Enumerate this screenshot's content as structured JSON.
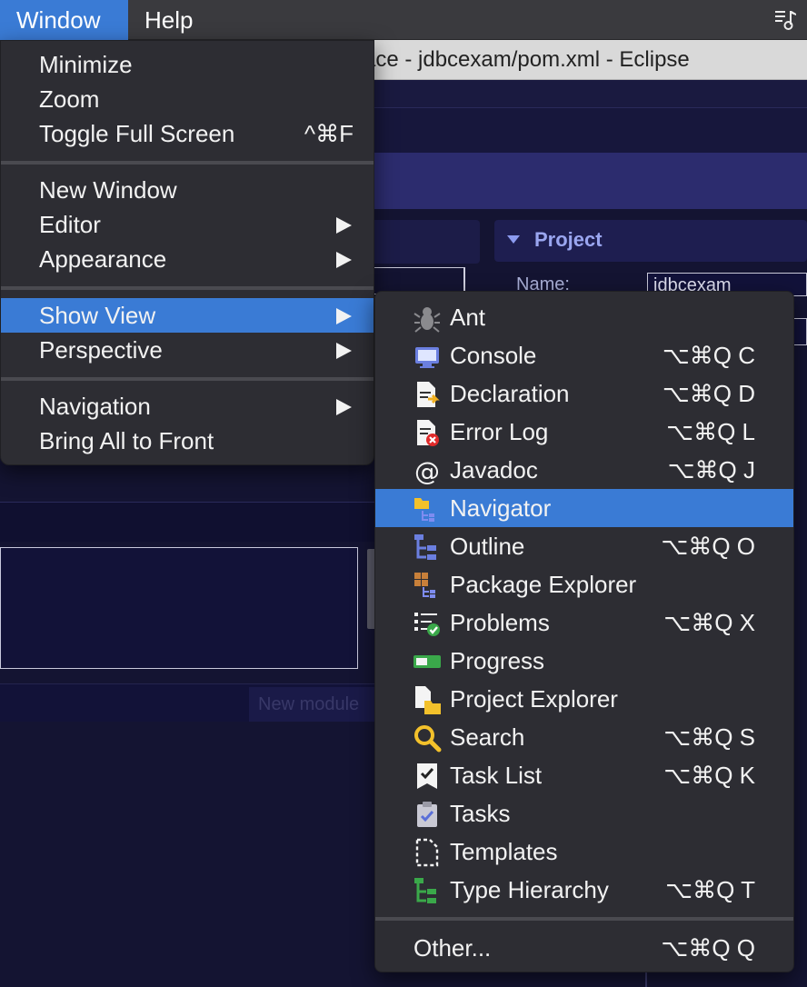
{
  "menubar": {
    "window_label": "Window",
    "help_label": "Help",
    "status_icon": "music-note-list-icon"
  },
  "background_window": {
    "title": "ace - jdbcexam/pom.xml - Eclipse",
    "section_title": "Project",
    "name_label": "Name:",
    "name_value": "jdbcexam",
    "button_label": "New module"
  },
  "window_menu": {
    "items": [
      {
        "label": "Minimize",
        "shortcut": ""
      },
      {
        "label": "Zoom",
        "shortcut": ""
      },
      {
        "label": "Toggle Full Screen",
        "shortcut": "^⌘F"
      },
      {
        "label": "New Window",
        "shortcut": ""
      },
      {
        "label": "Editor",
        "submenu": true
      },
      {
        "label": "Appearance",
        "submenu": true
      },
      {
        "label": "Show View",
        "submenu": true,
        "highlighted": true
      },
      {
        "label": "Perspective",
        "submenu": true
      },
      {
        "label": "Navigation",
        "submenu": true
      },
      {
        "label": "Bring All to Front",
        "shortcut": ""
      }
    ]
  },
  "show_view_menu": {
    "items": [
      {
        "label": "Ant",
        "shortcut": "",
        "icon": "ant-bug-icon"
      },
      {
        "label": "Console",
        "shortcut": "⌥⌘Q C",
        "icon": "console-icon"
      },
      {
        "label": "Declaration",
        "shortcut": "⌥⌘Q D",
        "icon": "declaration-icon"
      },
      {
        "label": "Error Log",
        "shortcut": "⌥⌘Q L",
        "icon": "error-log-icon"
      },
      {
        "label": "Javadoc",
        "shortcut": "⌥⌘Q J",
        "icon": "javadoc-at-icon"
      },
      {
        "label": "Navigator",
        "shortcut": "",
        "icon": "navigator-folder-icon",
        "highlighted": true
      },
      {
        "label": "Outline",
        "shortcut": "⌥⌘Q O",
        "icon": "outline-icon"
      },
      {
        "label": "Package Explorer",
        "shortcut": "",
        "icon": "package-explorer-icon"
      },
      {
        "label": "Problems",
        "shortcut": "⌥⌘Q X",
        "icon": "problems-icon"
      },
      {
        "label": "Progress",
        "shortcut": "",
        "icon": "progress-icon"
      },
      {
        "label": "Project Explorer",
        "shortcut": "",
        "icon": "project-explorer-icon"
      },
      {
        "label": "Search",
        "shortcut": "⌥⌘Q S",
        "icon": "search-icon"
      },
      {
        "label": "Task List",
        "shortcut": "⌥⌘Q K",
        "icon": "task-list-icon"
      },
      {
        "label": "Tasks",
        "shortcut": "",
        "icon": "tasks-clipboard-icon"
      },
      {
        "label": "Templates",
        "shortcut": "",
        "icon": "templates-icon"
      },
      {
        "label": "Type Hierarchy",
        "shortcut": "⌥⌘Q T",
        "icon": "type-hierarchy-icon"
      }
    ],
    "other": {
      "label": "Other...",
      "shortcut": "⌥⌘Q Q"
    }
  },
  "colors": {
    "accent": "#3a7bd5",
    "menu_bg": "#2d2d33",
    "app_bg": "#141432"
  }
}
